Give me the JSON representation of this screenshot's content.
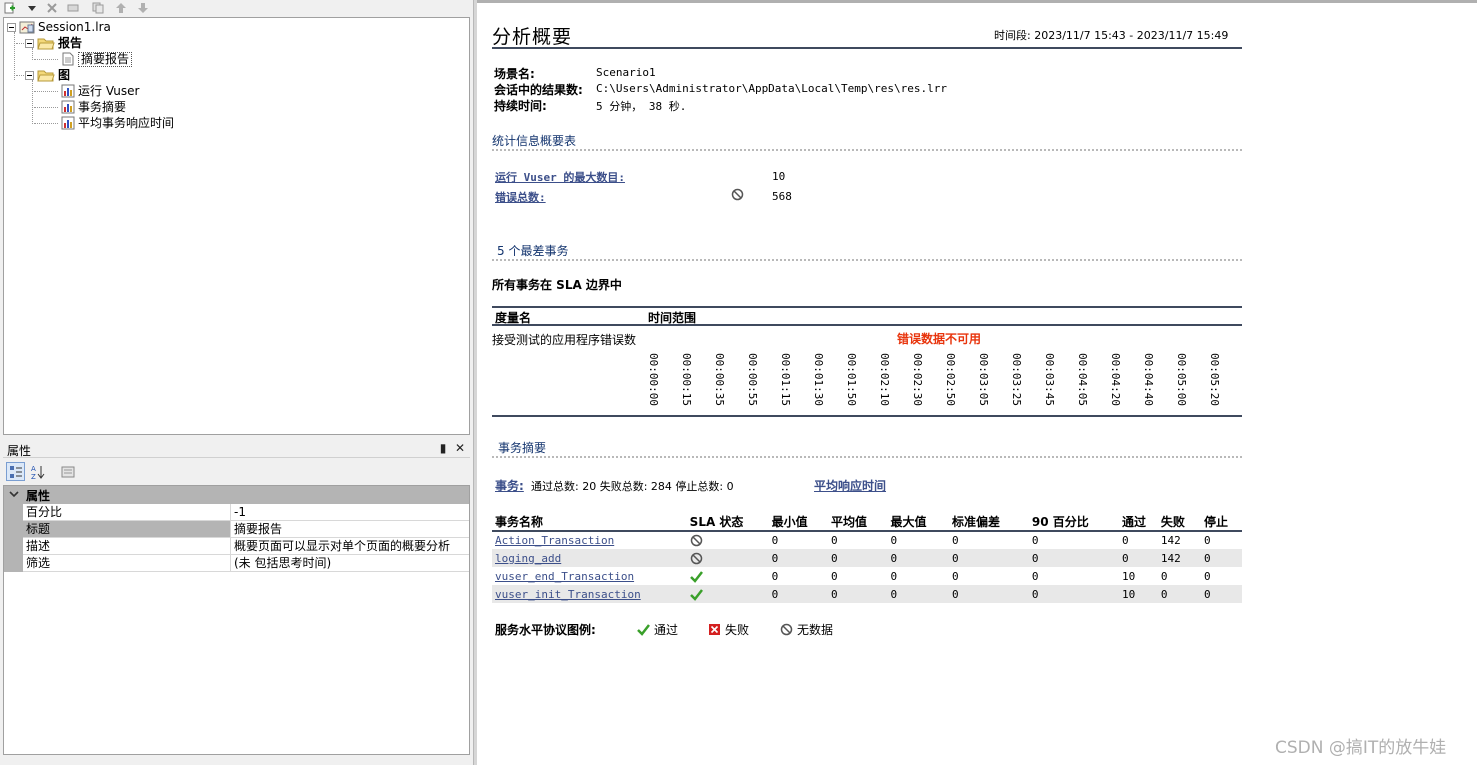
{
  "tree": {
    "session": "Session1.lra",
    "reports_folder": "报告",
    "summary_report": "摘要报告",
    "graphs_folder": "图",
    "graph_running_vusers": "运行 Vuser",
    "graph_transaction_summary": "事务摘要",
    "graph_avg_response": "平均事务响应时间"
  },
  "properties": {
    "panel_title": "属性",
    "pin_glyph": "▮",
    "close_glyph": "✕",
    "category": "属性",
    "rows": [
      {
        "name": "百分比",
        "value": "-1"
      },
      {
        "name": "标题",
        "value": "摘要报告"
      },
      {
        "name": "描述",
        "value": "概要页面可以显示对单个页面的概要分析"
      },
      {
        "name": "筛选",
        "value": "(未 包括思考时间)"
      }
    ]
  },
  "report": {
    "title": "分析概要",
    "period": "时间段: 2023/11/7 15:43 - 2023/11/7 15:49",
    "scenario_label": "场景名:",
    "scenario_value": "Scenario1",
    "results_label": "会话中的结果数:",
    "results_value": "C:\\Users\\Administrator\\AppData\\Local\\Temp\\res\\res.lrr",
    "duration_label": "持续时间:",
    "duration_value": "5 分钟， 38 秒.",
    "stats_title": "统计信息概要表",
    "max_vusers_label": "运行 Vuser 的最大数目:",
    "max_vusers_value": "10",
    "total_errors_label": "错误总数:",
    "total_errors_value": "568",
    "worst_title": "5 个最差事务",
    "sla_heading": "所有事务在 SLA 边界中",
    "measure_col": "度量名",
    "range_col": "时间范围",
    "measure_row": "接受测试的应用程序错误数",
    "error_unavailable": "错误数据不可用",
    "ticks": [
      "00:00:00",
      "00:00:15",
      "00:00:35",
      "00:00:55",
      "00:01:15",
      "00:01:30",
      "00:01:50",
      "00:02:10",
      "00:02:30",
      "00:02:50",
      "00:03:05",
      "00:03:25",
      "00:03:45",
      "00:04:05",
      "00:04:20",
      "00:04:40",
      "00:05:00",
      "00:05:20"
    ],
    "tx_summary_title": "事务摘要",
    "tx_link": "事务:",
    "tx_counts": "通过总数: 20 失败总数: 284 停止总数: 0",
    "avg_response_link": "平均响应时间",
    "table_headers": [
      "事务名称",
      "SLA 状态",
      "最小值",
      "平均值",
      "最大值",
      "标准偏差",
      "90 百分比",
      "通过",
      "失败",
      "停止"
    ],
    "table_rows": [
      {
        "name": "Action_Transaction",
        "status": "none",
        "min": "0",
        "avg": "0",
        "max": "0",
        "std": "0",
        "p90": "0",
        "pass": "0",
        "fail": "142",
        "stop": "0"
      },
      {
        "name": "loging_add",
        "status": "none",
        "min": "0",
        "avg": "0",
        "max": "0",
        "std": "0",
        "p90": "0",
        "pass": "0",
        "fail": "142",
        "stop": "0"
      },
      {
        "name": "vuser_end_Transaction",
        "status": "pass",
        "min": "0",
        "avg": "0",
        "max": "0",
        "std": "0",
        "p90": "0",
        "pass": "10",
        "fail": "0",
        "stop": "0"
      },
      {
        "name": "vuser_init_Transaction",
        "status": "pass",
        "min": "0",
        "avg": "0",
        "max": "0",
        "std": "0",
        "p90": "0",
        "pass": "10",
        "fail": "0",
        "stop": "0"
      }
    ],
    "legend_title": "服务水平协议图例:",
    "legend_pass": "通过",
    "legend_fail": "失败",
    "legend_nodata": "无数据"
  },
  "watermark": "CSDN @搞IT的放牛娃",
  "colors": {
    "link": "#3c4f8a",
    "section_title": "#14356f",
    "error_red": "#e8340c",
    "table_rule": "#3f4a5e",
    "pass_green": "#3aa02a",
    "fail_red": "#d42020"
  }
}
